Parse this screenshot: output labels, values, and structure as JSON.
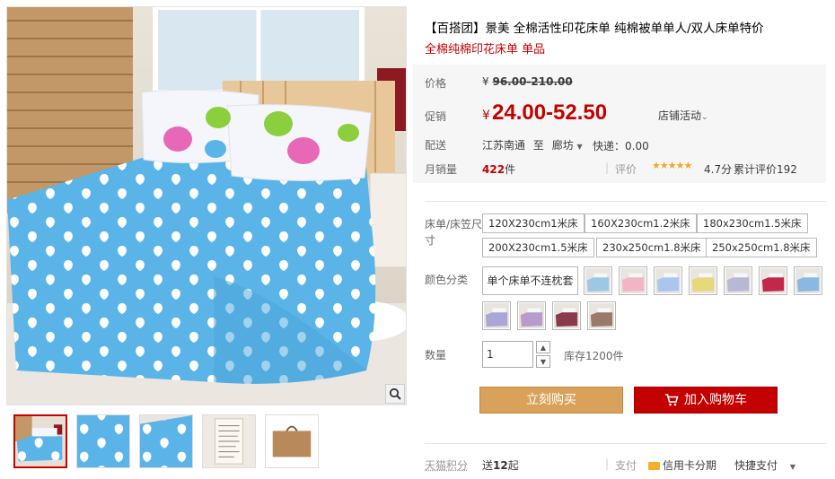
{
  "product": {
    "title": "【百搭团】景美 全棉活性印花床单 纯棉被单单人/双人床单特价",
    "subtitle": "全棉纯棉印花床单 单品"
  },
  "price": {
    "label": "价格",
    "currency": "¥",
    "original": "96.00-210.00"
  },
  "promo": {
    "label": "促销",
    "currency": "¥",
    "price": "24.00-52.50",
    "activity": "店铺活动"
  },
  "shipping": {
    "label": "配送",
    "from": "江苏南通",
    "to_word": "至",
    "to": "廊坊",
    "fee": "快递：0.00"
  },
  "stats": {
    "monthly_label": "月销量",
    "monthly_count": "422",
    "monthly_unit": "件",
    "review_label": "评价",
    "stars": "★★★★★",
    "score": "4.7分",
    "reviews_total": "累计评价192"
  },
  "sku": {
    "size_label_1": "床单/床笠尺",
    "size_label_2": "寸",
    "sizes": [
      "120X230cm1米床",
      "160X230cm1.2米床",
      "180x230cm1.5米床",
      "200X230cm1.5米床",
      "230x250cm1.8米床",
      "250x250cm1.8米床"
    ],
    "color_label": "颜色分类",
    "color_text_option": "单个床单不连枕套",
    "swatch_colors": [
      "#9cc8e6",
      "#f0b6c6",
      "#a9c6ee",
      "#e7d87a",
      "#b8b8d6",
      "#c2284a",
      "#8ab8e0",
      "#a9a6d8",
      "#b89bcc",
      "#8a3a4c",
      "#9a7a6a"
    ]
  },
  "quantity": {
    "label": "数量",
    "value": "1",
    "stock": "库存1200件"
  },
  "actions": {
    "buy_now": "立刻购买",
    "add_to_cart": "加入购物车"
  },
  "footer": {
    "points_label": "天猫积分",
    "points_prefix": "送",
    "points_value": "12",
    "points_suffix": "起",
    "pay_label": "支付",
    "credit_installment": "信用卡分期",
    "quick_pay": "快捷支付"
  },
  "colors": {
    "accent_red": "#c40000",
    "buy_now_bg": "#d8a25a",
    "star": "#f5a623"
  }
}
